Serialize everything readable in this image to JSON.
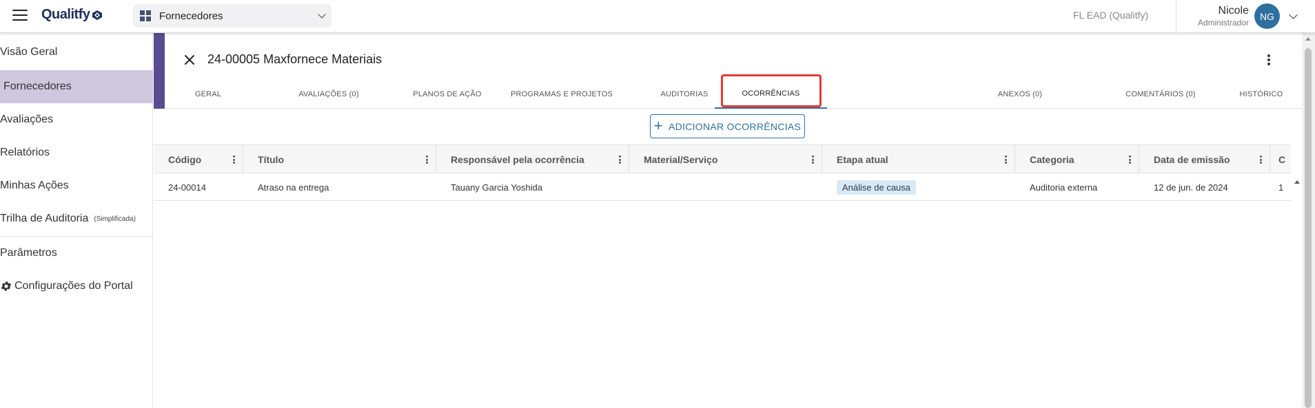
{
  "header": {
    "logo_text": "Qualitfy",
    "module_label": "Fornecedores",
    "tenant": "FL EAD (Qualitfy)",
    "user_name": "Nicole",
    "user_role": "Administrador",
    "avatar_initials": "NG"
  },
  "sidebar": {
    "items": [
      {
        "label": "Visão Geral"
      },
      {
        "label": "Fornecedores"
      },
      {
        "label": "Avaliações"
      },
      {
        "label": "Relatórios"
      },
      {
        "label": "Minhas Ações"
      },
      {
        "label": "Trilha de Auditoria",
        "suffix": "(Simplificada)"
      },
      {
        "label": "Parâmetros"
      },
      {
        "label": "Configurações do Portal"
      }
    ],
    "active_index": 1
  },
  "record": {
    "title": "24-00005 Maxfornece Materiais"
  },
  "tabs": [
    {
      "label": "GERAL"
    },
    {
      "label": "AVALIAÇÕES (0)"
    },
    {
      "label": "PLANOS DE AÇÃO"
    },
    {
      "label": "PROGRAMAS E PROJETOS"
    },
    {
      "label": "AUDITORIAS"
    },
    {
      "label": "OCORRÊNCIAS"
    },
    {
      "label": "ANEXOS (0)"
    },
    {
      "label": "COMENTÁRIOS (0)"
    },
    {
      "label": "HISTÓRICO"
    }
  ],
  "active_tab": 5,
  "add_button_label": "ADICIONAR OCORRÊNCIAS",
  "table": {
    "columns": [
      "Código",
      "Título",
      "Responsável pela ocorrência",
      "Material/Serviço",
      "Etapa atual",
      "Categoria",
      "Data de emissão",
      "C"
    ],
    "rows": [
      {
        "codigo": "24-00014",
        "titulo": "Atraso na entrega",
        "responsavel": "Tauany Garcia Yoshida",
        "material": "",
        "etapa": "Análise de causa",
        "categoria": "Auditoria externa",
        "data": "12 de jun. de 2024",
        "extra": "1"
      }
    ]
  },
  "colors": {
    "accent": "#5b4c92",
    "sidebar_active": "#cdc8de",
    "primary_blue": "#2e6f9e",
    "highlight_red": "#e53935",
    "badge_bg": "#d9e8f5"
  }
}
